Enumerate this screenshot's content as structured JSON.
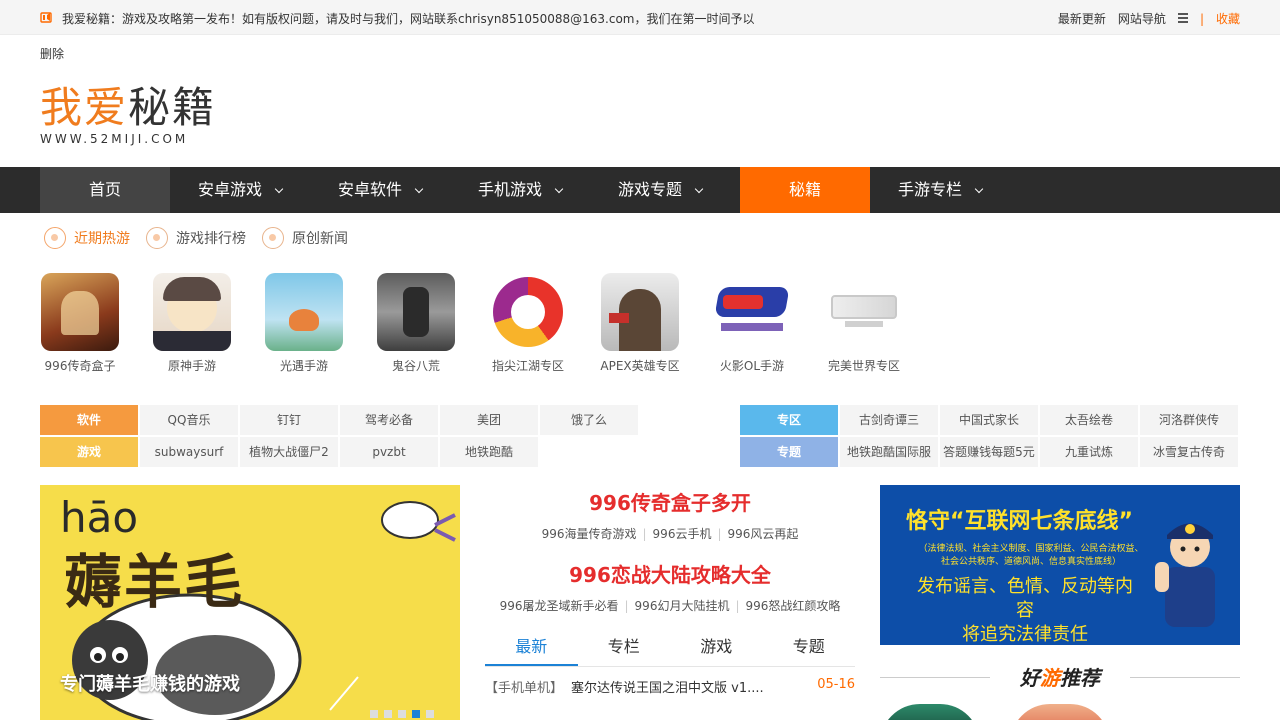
{
  "topbar": {
    "notice": "我爱秘籍：游戏及攻略第一发布！如有版权问题，请及时与我们，网站联系chrisyn851050088@163.com，我们在第一时间予以",
    "links": [
      "最新更新",
      "网站导航"
    ],
    "divider": "|",
    "favorite": "收藏"
  },
  "delete_text": "删除",
  "logo": {
    "cn_orange": "我爱",
    "cn_dark": "秘籍",
    "en": "WWW.52MIJI.COM"
  },
  "nav": {
    "items": [
      {
        "label": "首页",
        "dropdown": false
      },
      {
        "label": "安卓游戏",
        "dropdown": true
      },
      {
        "label": "安卓软件",
        "dropdown": true
      },
      {
        "label": "手机游戏",
        "dropdown": true
      },
      {
        "label": "游戏专题",
        "dropdown": true
      },
      {
        "label": "秘籍",
        "dropdown": false
      },
      {
        "label": "手游专栏",
        "dropdown": true
      }
    ]
  },
  "subtabs": [
    {
      "label": "近期热游",
      "active": true
    },
    {
      "label": "游戏排行榜",
      "active": false
    },
    {
      "label": "原创新闻",
      "active": false
    }
  ],
  "games": [
    {
      "name": "996传奇盒子"
    },
    {
      "name": "原神手游"
    },
    {
      "name": "光遇手游"
    },
    {
      "name": "鬼谷八荒"
    },
    {
      "name": "指尖江湖专区"
    },
    {
      "name": "APEX英雄专区"
    },
    {
      "name": "火影OL手游"
    },
    {
      "name": "完美世界专区"
    }
  ],
  "tags_left": {
    "rows": [
      {
        "head": "软件",
        "color": "#f59a3f",
        "cells": [
          "QQ音乐",
          "钉钉",
          "驾考必备",
          "美团",
          "饿了么"
        ]
      },
      {
        "head": "游戏",
        "color": "#f7c54d",
        "cells": [
          "subwaysurf",
          "植物大战僵尸2",
          "pvzbt",
          "地铁跑酷"
        ]
      }
    ]
  },
  "tags_right": {
    "rows": [
      {
        "head": "专区",
        "color": "#5ab8ec",
        "cells": [
          "古剑奇谭三",
          "中国式家长",
          "太吾绘卷",
          "河洛群侠传"
        ]
      },
      {
        "head": "专题",
        "color": "#8fb2e6",
        "cells": [
          "地铁跑酷国际服",
          "答题赚钱每题5元",
          "九重试炼",
          "冰雪复古传奇"
        ]
      }
    ]
  },
  "banner": {
    "pinyin": "hāo",
    "big": "薅羊毛",
    "caption": "专门薅羊毛赚钱的游戏",
    "slides": 5,
    "active_slide": 4
  },
  "mid": {
    "headline1": "996传奇盒子多开",
    "links1": [
      "996海量传奇游戏",
      "996云手机",
      "996风云再起"
    ],
    "headline2": "996恋战大陆攻略大全",
    "links2": [
      "996屠龙圣域新手必看",
      "996幻月大陆挂机",
      "996怒战红颜攻略"
    ],
    "tabs": [
      {
        "label": "最新",
        "active": true
      },
      {
        "label": "专栏",
        "active": false
      },
      {
        "label": "游戏",
        "active": false
      },
      {
        "label": "专题",
        "active": false
      }
    ],
    "news": [
      {
        "cat": "【手机单机】",
        "title": "塞尔达传说王国之泪中文版 v1....",
        "date": "05-16"
      }
    ]
  },
  "ad": {
    "title": "恪守“互联网七条底线”",
    "small": "（法律法规、社会主义制度、国家利益、公民合法权益、社会公共秩序、道德风尚、信息真实性底线）",
    "warn_line1": "发布谣言、色情、反动等内容",
    "warn_line2": "将追究法律责任"
  },
  "recommend": {
    "pre": "好",
    "mid": "游",
    "post": "推荐"
  }
}
